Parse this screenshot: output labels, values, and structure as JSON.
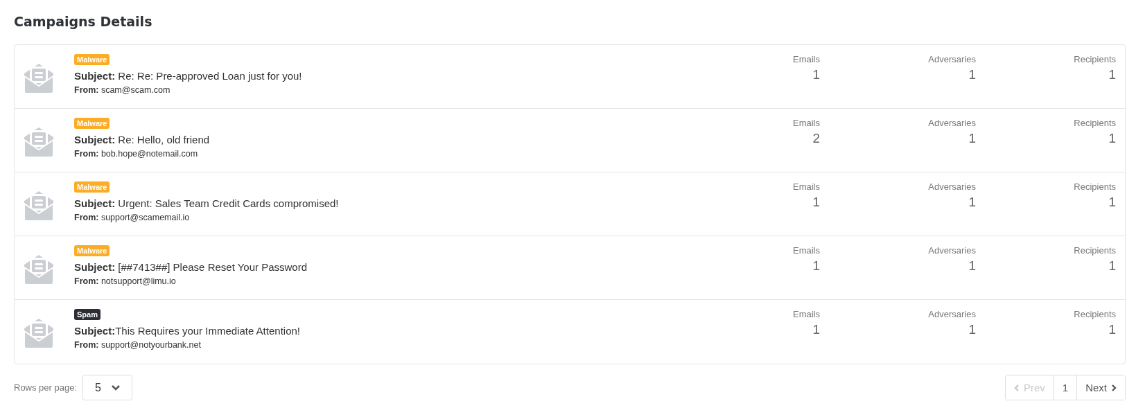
{
  "title": "Campaigns Details",
  "campaigns": [
    {
      "tag": {
        "label": "Malware",
        "color": "#fbad26"
      },
      "subject_label": "Subject:",
      "subject": " Re: Re: Pre-approved Loan just for you!",
      "from_label": "From:",
      "from": "scam@scam.com",
      "stats": [
        {
          "label": "Emails",
          "value": "1"
        },
        {
          "label": "Adversaries",
          "value": "1"
        },
        {
          "label": "Recipients",
          "value": "1"
        }
      ]
    },
    {
      "tag": {
        "label": "Malware",
        "color": "#fbad26"
      },
      "subject_label": "Subject:",
      "subject": " Re: Hello, old friend",
      "from_label": "From:",
      "from": "bob.hope@notemail.com",
      "stats": [
        {
          "label": "Emails",
          "value": "2"
        },
        {
          "label": "Adversaries",
          "value": "1"
        },
        {
          "label": "Recipients",
          "value": "1"
        }
      ]
    },
    {
      "tag": {
        "label": "Malware",
        "color": "#fbad26"
      },
      "subject_label": "Subject:",
      "subject": " Urgent: Sales Team Credit Cards compromised!",
      "from_label": "From:",
      "from": "support@scamemail.io",
      "stats": [
        {
          "label": "Emails",
          "value": "1"
        },
        {
          "label": "Adversaries",
          "value": "1"
        },
        {
          "label": "Recipients",
          "value": "1"
        }
      ]
    },
    {
      "tag": {
        "label": "Malware",
        "color": "#fbad26"
      },
      "subject_label": "Subject:",
      "subject": " [##7413##] Please Reset Your Password",
      "from_label": "From:",
      "from": "notsupport@limu.io",
      "stats": [
        {
          "label": "Emails",
          "value": "1"
        },
        {
          "label": "Adversaries",
          "value": "1"
        },
        {
          "label": "Recipients",
          "value": "1"
        }
      ]
    },
    {
      "tag": {
        "label": "Spam",
        "color": "#2b2f33"
      },
      "subject_label": "Subject:",
      "subject": "This Requires your Immediate Attention!",
      "from_label": "From:",
      "from": "support@notyourbank.net",
      "stats": [
        {
          "label": "Emails",
          "value": "1"
        },
        {
          "label": "Adversaries",
          "value": "1"
        },
        {
          "label": "Recipients",
          "value": "1"
        }
      ]
    }
  ],
  "footer": {
    "rows_label": "Rows per page:",
    "rows_value": "5",
    "prev": {
      "label": "Prev",
      "disabled": true
    },
    "page": "1",
    "next": {
      "label": "Next",
      "disabled": false
    }
  }
}
